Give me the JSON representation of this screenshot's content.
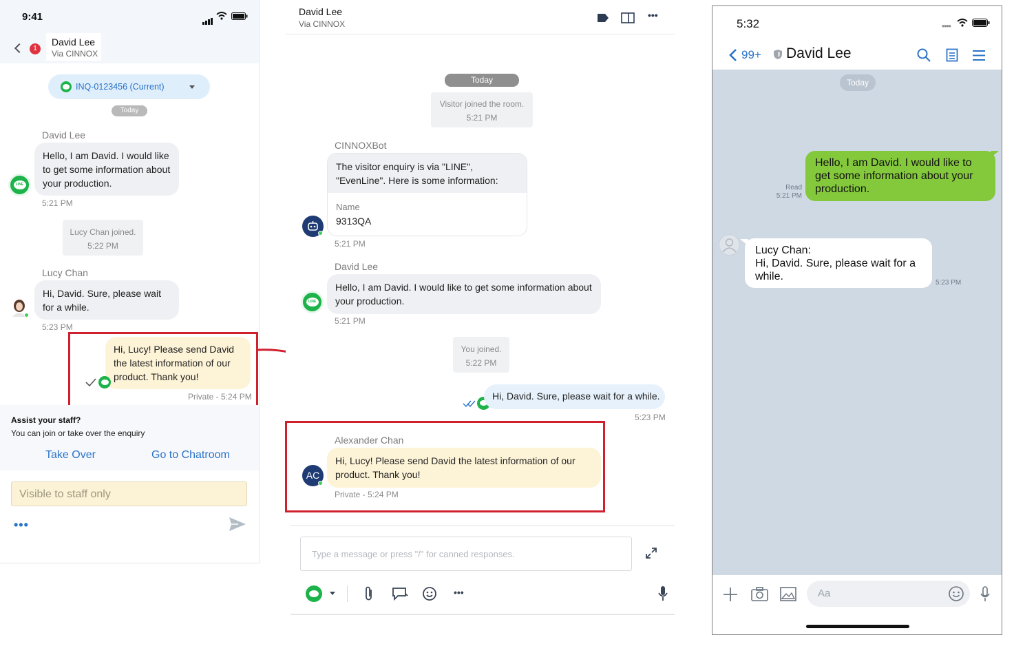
{
  "mobile": {
    "status_time": "9:41",
    "header": {
      "badge": "1",
      "name": "David Lee",
      "via": "Via CINNOX"
    },
    "enquiry_selector": "INQ-0123456 (Current)",
    "day": "Today",
    "messages": {
      "david_sender": "David Lee",
      "david_text": "Hello, I am David. I would like to get some information about your production.",
      "david_time": "5:21 PM",
      "lucy_joined": "Lucy Chan joined.",
      "lucy_joined_time": "5:22 PM",
      "lucy_sender": "Lucy Chan",
      "lucy_text": "Hi, David. Sure, please wait for a while.",
      "lucy_time": "5:23 PM",
      "private_text": "Hi, Lucy! Please send David the latest information of our product. Thank you!",
      "private_meta": "Private - 5:24 PM"
    },
    "assist": {
      "title": "Assist your staff?",
      "subtitle": "You can join or take over the enquiry",
      "take_over": "Take Over",
      "go_to_chatroom": "Go to Chatroom"
    },
    "composer_placeholder": "Visible to staff only"
  },
  "console": {
    "header": {
      "name": "David Lee",
      "via": "Via CINNOX"
    },
    "day": "Today",
    "visitor_joined": "Visitor joined the room.",
    "visitor_joined_time": "5:21 PM",
    "bot_sender": "CINNOXBot",
    "bot_text": "The visitor enquiry is via \"LINE\", \"EvenLine\". Here is some information:",
    "bot_field_label": "Name",
    "bot_field_value": "9313QA",
    "bot_time": "5:21 PM",
    "david_sender": "David Lee",
    "david_text": "Hello, I am David. I would like to get some information about your production.",
    "david_time": "5:21 PM",
    "you_joined": "You joined.",
    "you_joined_time": "5:22 PM",
    "reply_text": "Hi, David. Sure, please wait for a while.",
    "reply_time": "5:23 PM",
    "alex_sender": "Alexander Chan",
    "alex_avatar": "AC",
    "alex_text": "Hi, Lucy! Please send David the latest information of our product. Thank you!",
    "alex_meta": "Private - 5:24 PM",
    "composer_placeholder": "Type a message or press \"/\" for canned responses."
  },
  "line_app": {
    "status_time": "5:32",
    "back_count": "99+",
    "title": "David Lee",
    "day": "Today",
    "read_label": "Read",
    "sent_time": "5:21 PM",
    "sent_text": "Hello, I am David. I would like to get some information about your production.",
    "recv_sender": "Lucy Chan:",
    "recv_text": "Hi, David. Sure, please wait for a while.",
    "recv_time": "5:23 PM",
    "input_placeholder": "Aa"
  },
  "colors": {
    "accent_blue": "#2a73c8",
    "line_green": "#1db34a",
    "line_bubble_green": "#84c83c",
    "private_yellow": "#fdf3d7",
    "highlight_red": "#d0202e"
  }
}
